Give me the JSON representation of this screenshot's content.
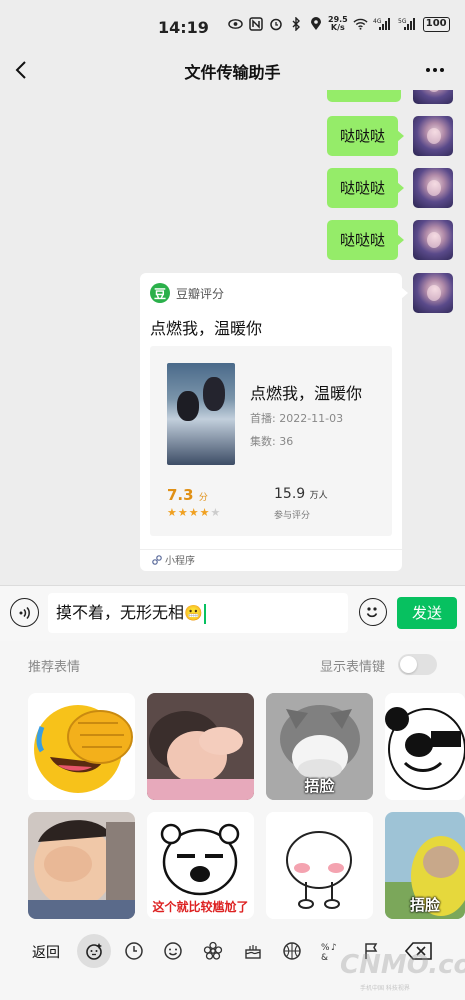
{
  "status_bar": {
    "time": "14:19",
    "net_speed_value": "29.5",
    "net_speed_unit": "K/s",
    "signal_1": "4G",
    "signal_2": "5G",
    "battery": "100"
  },
  "header": {
    "title": "文件传输助手"
  },
  "messages": [
    {
      "type": "text",
      "text": "哒哒哒"
    },
    {
      "type": "text",
      "text": "哒哒哒"
    },
    {
      "type": "text",
      "text": "哒哒哒"
    }
  ],
  "card": {
    "source": "豆瓣评分",
    "source_logo": "豆",
    "title": "点燃我，温暖你",
    "movie_name": "点燃我，温暖你",
    "premiere": "首播: 2022-11-03",
    "episodes": "集数: 36",
    "rating": "7.3",
    "rating_unit": "分",
    "stars": 3.5,
    "count": "15.9",
    "count_unit": "万人",
    "count_label": "参与评分",
    "footer": "小程序"
  },
  "input": {
    "text": "摸不着，无形无相",
    "send_label": "发送"
  },
  "sticker_panel": {
    "title": "推荐表情",
    "toggle_label": "显示表情键",
    "toggle_on": false,
    "stickers": [
      {
        "name": "facepalm-emoji",
        "caption": ""
      },
      {
        "name": "baby-hide",
        "caption": ""
      },
      {
        "name": "cat-cover",
        "caption": "捂脸"
      },
      {
        "name": "panda-cover",
        "caption": ""
      },
      {
        "name": "kid-cover",
        "caption": ""
      },
      {
        "name": "bear-awkward",
        "caption": "这个就比较尴尬了"
      },
      {
        "name": "blush-cover",
        "caption": ""
      },
      {
        "name": "teletubby-cover",
        "caption": "捂脸"
      }
    ]
  },
  "bottom_bar": {
    "back_label": "返回"
  },
  "watermark": {
    "text": "CNMO.com",
    "sub": "手机中国 科技视界"
  },
  "colors": {
    "bubble": "#95ec69",
    "send": "#07c160",
    "rating": "#e09015"
  }
}
